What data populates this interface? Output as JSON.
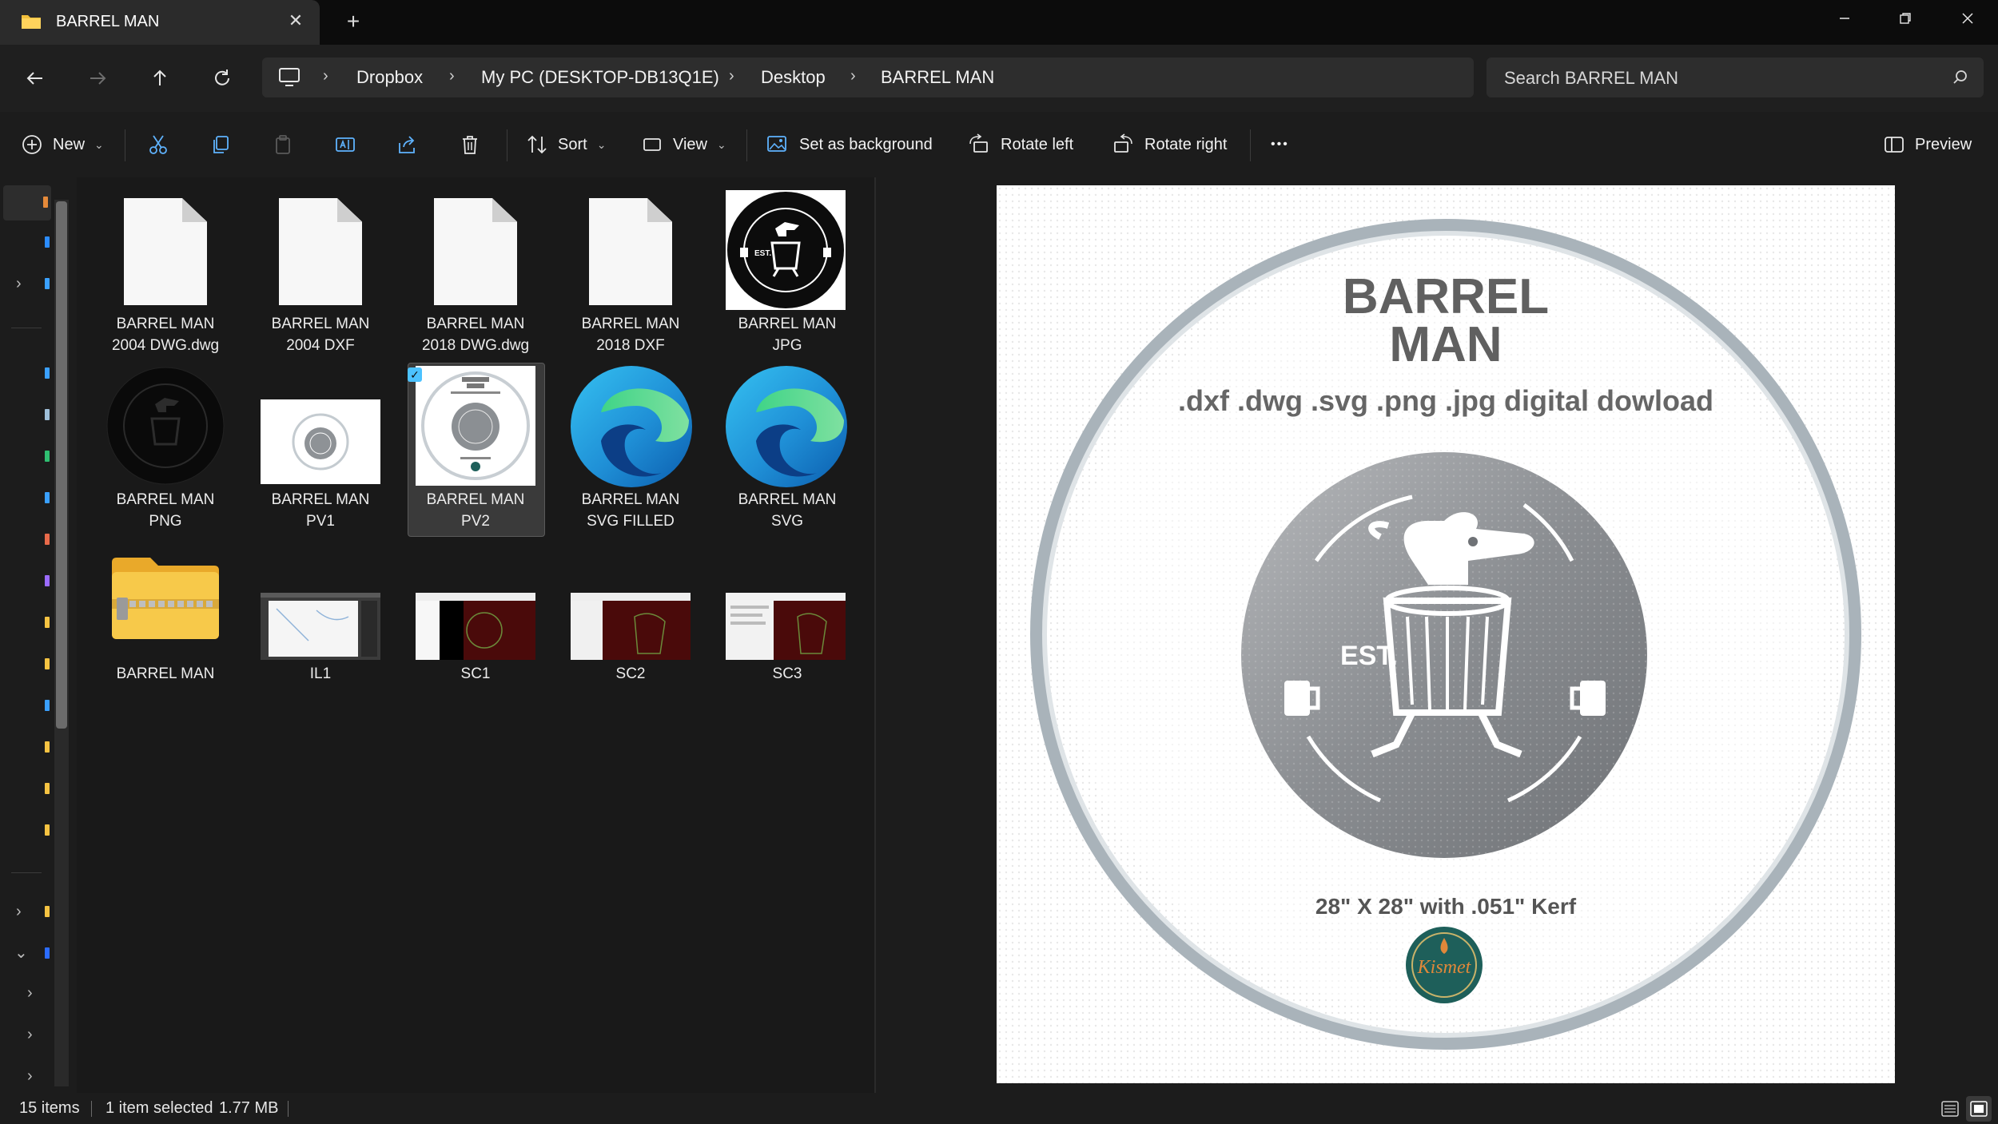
{
  "window": {
    "tab_title": "BARREL MAN",
    "close_tab_glyph": "✕",
    "new_tab_glyph": "+"
  },
  "breadcrumb": [
    "Dropbox",
    "My PC (DESKTOP-DB13Q1E)",
    "Desktop",
    "BARREL MAN"
  ],
  "search": {
    "placeholder": "Search BARREL MAN"
  },
  "toolbar": {
    "new_label": "New",
    "sort_label": "Sort",
    "view_label": "View",
    "set_background_label": "Set as background",
    "rotate_left_label": "Rotate left",
    "rotate_right_label": "Rotate right",
    "more_glyph": "•••",
    "preview_label": "Preview"
  },
  "files": [
    {
      "line1": "BARREL MAN",
      "line2": "2004 DWG.dwg",
      "kind": "document"
    },
    {
      "line1": "BARREL MAN",
      "line2": "2004 DXF",
      "kind": "document"
    },
    {
      "line1": "BARREL MAN",
      "line2": "2018 DWG.dwg",
      "kind": "document"
    },
    {
      "line1": "BARREL MAN",
      "line2": "2018 DXF",
      "kind": "document"
    },
    {
      "line1": "BARREL MAN",
      "line2": "JPG",
      "kind": "image-dark-logo"
    },
    {
      "line1": "BARREL MAN",
      "line2": "PNG",
      "kind": "image-black-logo"
    },
    {
      "line1": "BARREL MAN",
      "line2": "PV1",
      "kind": "image-white-preview"
    },
    {
      "line1": "BARREL MAN",
      "line2": "PV2",
      "kind": "image-white-preview",
      "selected": true
    },
    {
      "line1": "BARREL MAN",
      "line2": "SVG FILLED",
      "kind": "edge-icon"
    },
    {
      "line1": "BARREL MAN",
      "line2": "SVG",
      "kind": "edge-icon"
    },
    {
      "line1": "BARREL MAN",
      "line2": "",
      "kind": "zip-folder"
    },
    {
      "line1": "IL1",
      "line2": "",
      "kind": "screenshot"
    },
    {
      "line1": "SC1",
      "line2": "",
      "kind": "screenshot-red"
    },
    {
      "line1": "SC2",
      "line2": "",
      "kind": "screenshot-red"
    },
    {
      "line1": "SC3",
      "line2": "",
      "kind": "screenshot-red"
    }
  ],
  "preview": {
    "title_line1": "BARREL",
    "title_line2": "MAN",
    "subtitle": ".dxf .dwg .svg .png .jpg digital dowload",
    "emblem_text": "EST.",
    "size_text": "28\" X 28\" with .051\" Kerf",
    "brand_logo_text": "Kismet"
  },
  "status": {
    "item_count": "15 items",
    "selection": "1 item selected",
    "size": "1.77 MB"
  },
  "colors": {
    "accent": "#4cc2ff",
    "folder_yellow": "#f5c342",
    "selection_bg": "#3a3a3a"
  }
}
